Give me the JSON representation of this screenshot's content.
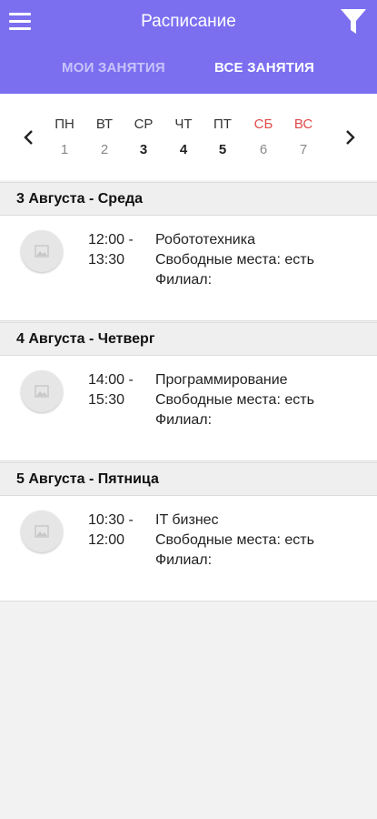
{
  "appbar": {
    "title": "Расписание"
  },
  "tabs": [
    {
      "label": "МОИ ЗАНЯТИЯ"
    },
    {
      "label": "ВСЕ ЗАНЯТИЯ"
    }
  ],
  "week": {
    "days": [
      {
        "name": "ПН",
        "date": "1"
      },
      {
        "name": "ВТ",
        "date": "2"
      },
      {
        "name": "СР",
        "date": "3"
      },
      {
        "name": "ЧТ",
        "date": "4"
      },
      {
        "name": "ПТ",
        "date": "5"
      },
      {
        "name": "СБ",
        "date": "6"
      },
      {
        "name": "ВС",
        "date": "7"
      }
    ]
  },
  "sections": [
    {
      "header": "3 Августа - Среда",
      "lesson": {
        "start": "12:00 -",
        "end": "13:30",
        "name": "Робототехника",
        "seats": "Свободные места: есть",
        "branch": "Филиал:"
      }
    },
    {
      "header": "4 Августа - Четверг",
      "lesson": {
        "start": "14:00 -",
        "end": "15:30",
        "name": "Программирование",
        "seats": "Свободные места: есть",
        "branch": "Филиал:"
      }
    },
    {
      "header": "5 Августа - Пятница",
      "lesson": {
        "start": "10:30 -",
        "end": "12:00",
        "name": "IT бизнес",
        "seats": "Свободные места: есть",
        "branch": "Филиал:"
      }
    }
  ],
  "colors": {
    "accent": "#7b6ff0",
    "weekend": "#e04a4a"
  },
  "icons": {
    "menu": "menu-icon",
    "filter": "filter-icon",
    "prev": "chevron-left-icon",
    "next": "chevron-right-icon",
    "thumb": "image-placeholder-icon"
  }
}
